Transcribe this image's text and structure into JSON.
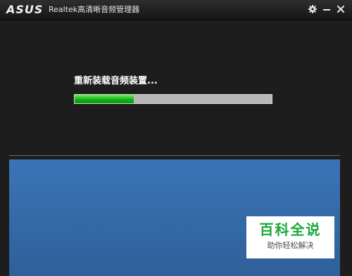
{
  "window": {
    "brand": "ASUS",
    "title": "Realtek高清晰音频管理器",
    "controls": {
      "settings_icon": "gear-icon",
      "minimize_icon": "minimize-icon",
      "close_icon": "close-icon"
    }
  },
  "main": {
    "status_text": "重新装载音频装置...",
    "progress": 0.3
  },
  "watermark": {
    "title": "百科全说",
    "subtitle": "助你轻松解决"
  },
  "colors": {
    "accent_green": "#1fbf2a",
    "panel_blue": "#3a6fa8",
    "watermark_green": "#1aa83a"
  }
}
